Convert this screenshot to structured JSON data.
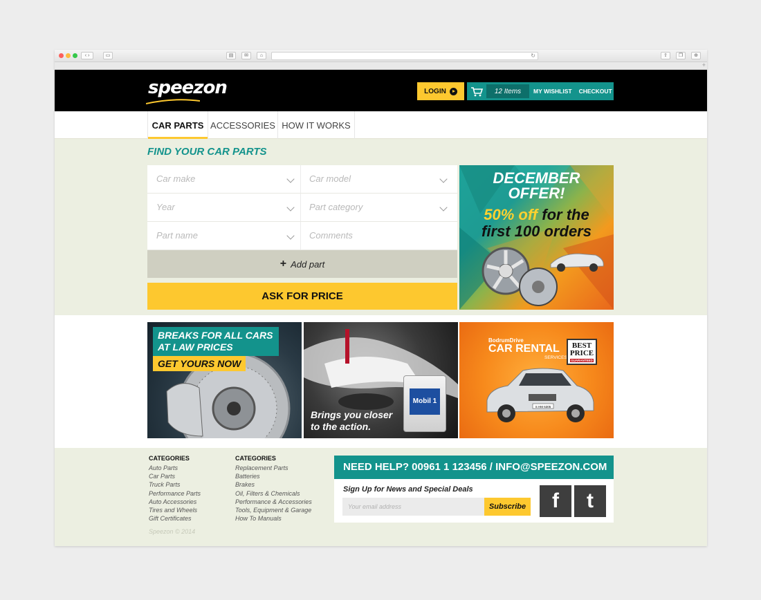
{
  "colors": {
    "teal": "#13938c",
    "yellow": "#fdc82f",
    "black": "#000000",
    "beige": "#ecefe1"
  },
  "header": {
    "logo": "speezon",
    "login_label": "LOGIN",
    "cart_count": "12 Items",
    "wishlist_label": "MY WISHLIST",
    "checkout_label": "CHECKOUT"
  },
  "nav": {
    "tabs": [
      {
        "label": "CAR PARTS",
        "active": true
      },
      {
        "label": "ACCESSORIES"
      },
      {
        "label": "HOW IT WORKS"
      }
    ]
  },
  "finder": {
    "title": "FIND YOUR CAR PARTS",
    "fields": {
      "car_make": "Car make",
      "car_model": "Car model",
      "year": "Year",
      "part_category": "Part category",
      "part_name": "Part name",
      "comments": "Comments"
    },
    "add_part_label": "Add part",
    "ask_price_label": "ASK FOR PRICE"
  },
  "promo": {
    "title_line1": "DECEMBER",
    "title_line2": "OFFER!",
    "highlight": "50% off",
    "rest_line1": "for the",
    "rest_line2": "first 100 orders"
  },
  "banners": {
    "brakes": {
      "headline": "BREAKS FOR ALL CARS AT LAW PRICES",
      "cta": "GET YOURS NOW"
    },
    "oil": {
      "line1": "Brings you closer",
      "line2": "to the action.",
      "bottle_label": "Mobil 1"
    },
    "rental": {
      "brand": "BodrumDrive",
      "title": "CAR RENTAL",
      "sub": "SERVICES",
      "badge_line1": "BEST",
      "badge_line2": "PRICE",
      "badge_small": "GUARANTEED",
      "plate": "S HM 6305"
    }
  },
  "footer": {
    "col1": {
      "heading": "CATEGORIES",
      "links": [
        "Auto Parts",
        "Car Parts",
        "Truck Parts",
        "Performance Parts",
        "Auto Accessories",
        "Tires and Wheels",
        "Gift Certificates"
      ]
    },
    "col2": {
      "heading": "CATEGORIES",
      "links": [
        "Replacement Parts",
        "Batteries",
        "Brakes",
        "Oil, Filters & Chemicals",
        "Performance & Accessories",
        "Tools, Equipment & Garage",
        "How To Manuals"
      ]
    },
    "copyright": "Speezon © 2014",
    "help": "NEED HELP?  00961 1 123456  / INFO@SPEEZON.COM",
    "signup_label": "Sign Up for News and Special Deals",
    "email_placeholder": "Your email address",
    "subscribe_label": "Subscribe",
    "facebook_glyph": "f",
    "twitter_glyph": "t"
  }
}
